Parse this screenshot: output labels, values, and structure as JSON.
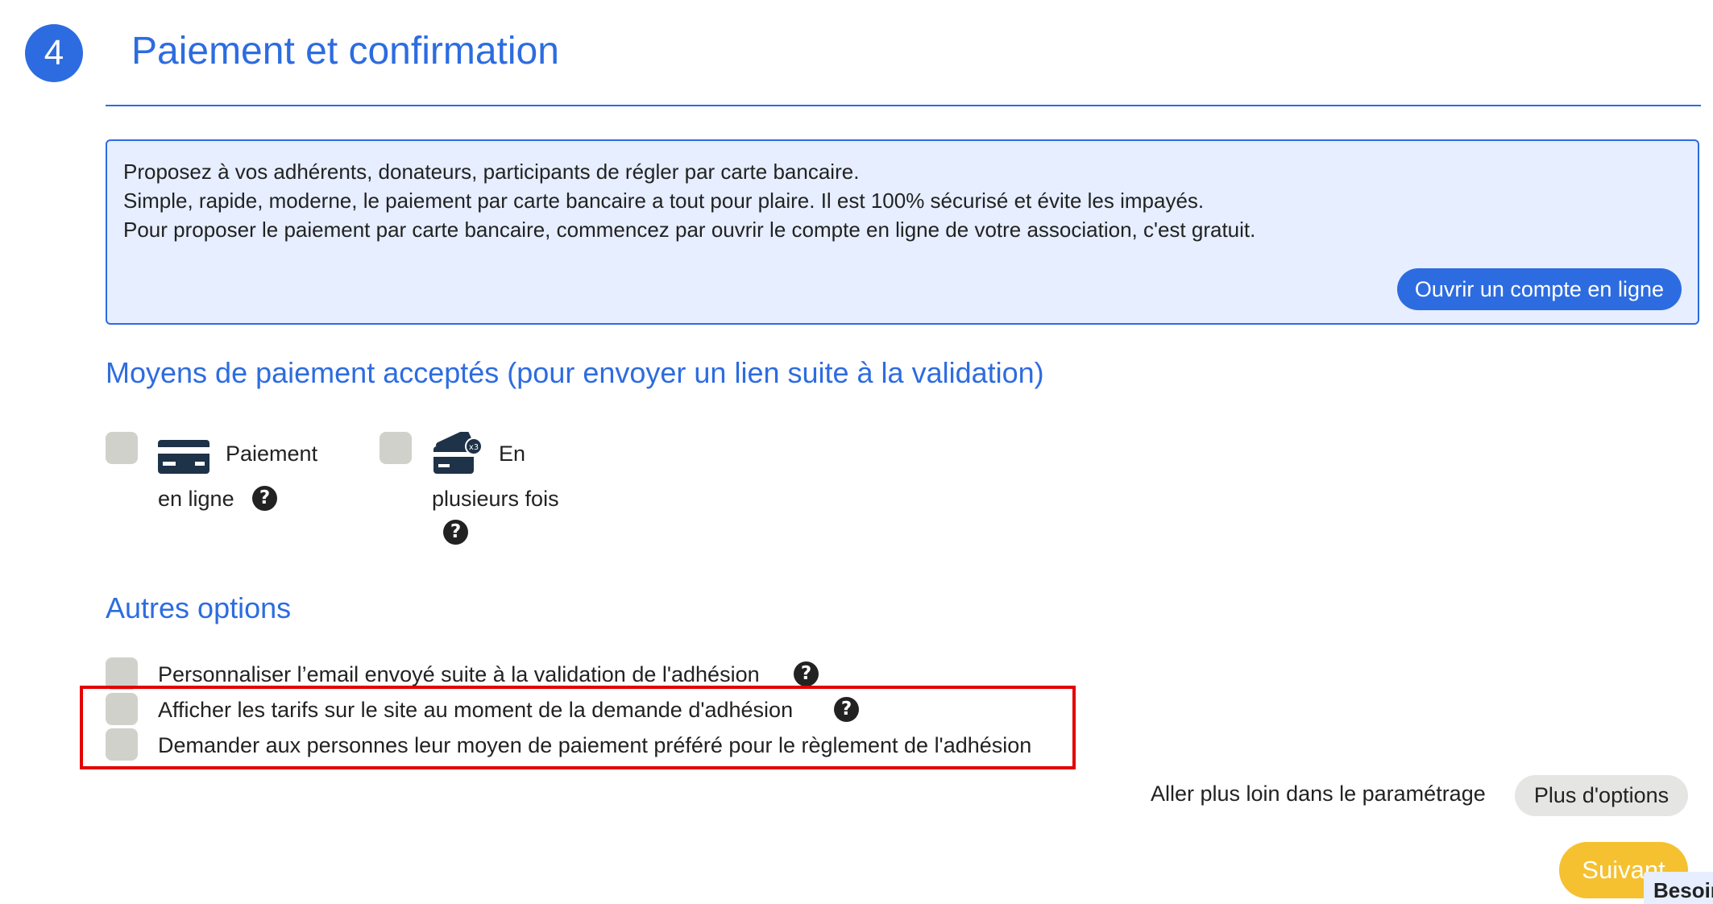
{
  "step": {
    "number": "4",
    "title": "Paiement et confirmation"
  },
  "info": {
    "line1": "Proposez à vos adhérents, donateurs, participants de régler par carte bancaire.",
    "line2": "Simple, rapide, moderne, le paiement par carte bancaire a tout pour plaire. Il est 100% sécurisé et évite les impayés.",
    "line3": "Pour proposer le paiement par carte bancaire, commencez par ouvrir le compte en ligne de votre association, c'est gratuit.",
    "button_label": "Ouvrir un compte en ligne"
  },
  "payment_methods": {
    "title": "Moyens de paiement acceptés (pour envoyer un lien suite à la validation)",
    "online": {
      "line1": "Paiement",
      "line2": "en ligne",
      "icon": "credit-card-icon"
    },
    "installments": {
      "line1": "En",
      "line2": "plusieurs fois",
      "icon": "cards-multiple-icon"
    },
    "help_glyph": "?"
  },
  "other_options": {
    "title": "Autres options",
    "items": [
      {
        "label": "Personnaliser l’email envoyé suite à la validation de l'adhésion",
        "checked": false
      },
      {
        "label": "Afficher les tarifs sur le site au moment de la demande d'adhésion",
        "checked": false
      },
      {
        "label": "Demander aux personnes leur moyen de paiement préféré pour le règlement de l'adhésion",
        "checked": false
      }
    ]
  },
  "advanced": {
    "label": "Aller plus loin dans le paramétrage",
    "button_label": "Plus d'options"
  },
  "next_button_label": "Suivant",
  "help_tab_label": "Besoin",
  "colors": {
    "accent": "#2d6ce0",
    "info_bg": "#e6eeff",
    "checkbox": "#d1d1cc",
    "highlight": "#e30000",
    "next": "#f5c130"
  }
}
